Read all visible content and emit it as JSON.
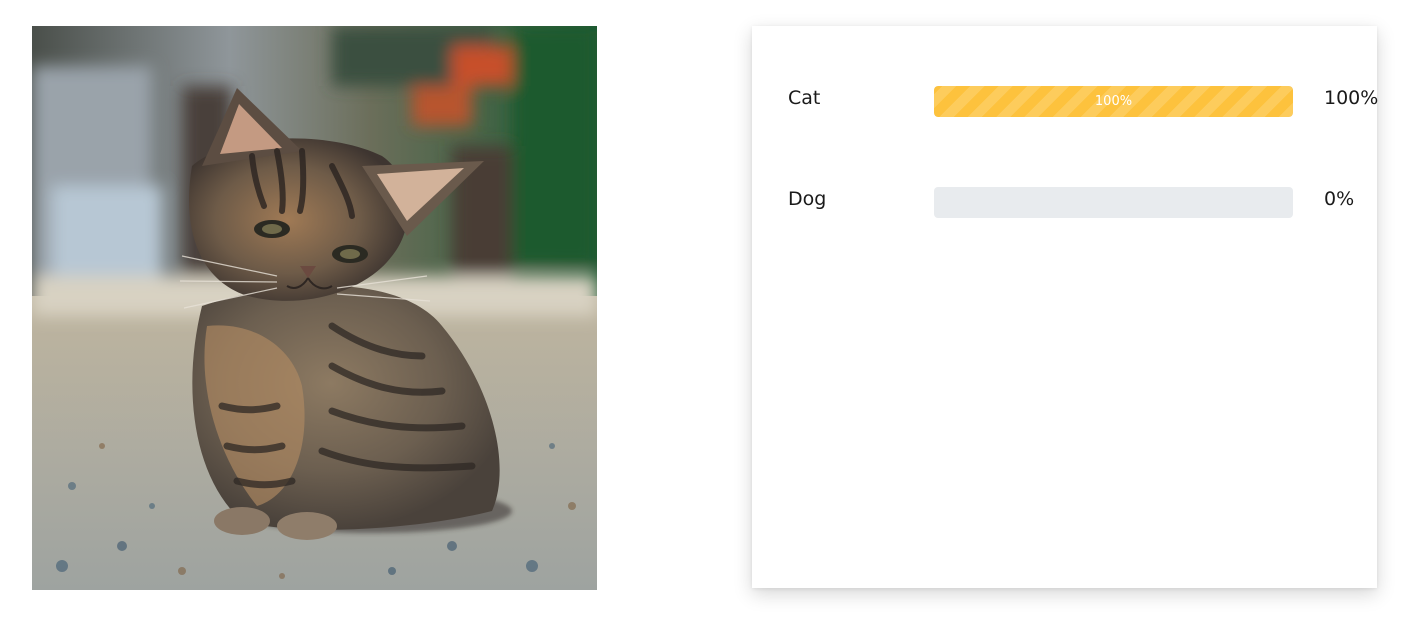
{
  "image": {
    "subject": "tabby-kitten-photo"
  },
  "results": [
    {
      "label": "Cat",
      "value": 1.0,
      "bar_text": "100%",
      "percent_text": "100%",
      "color": "#FDC23D"
    },
    {
      "label": "Dog",
      "value": 0.0,
      "bar_text": "",
      "percent_text": "0%",
      "color": "#FDC23D"
    }
  ],
  "colors": {
    "bar_fill": "#FDC23D",
    "bar_track": "#E8EBEE",
    "text": "#1A1A1A"
  }
}
